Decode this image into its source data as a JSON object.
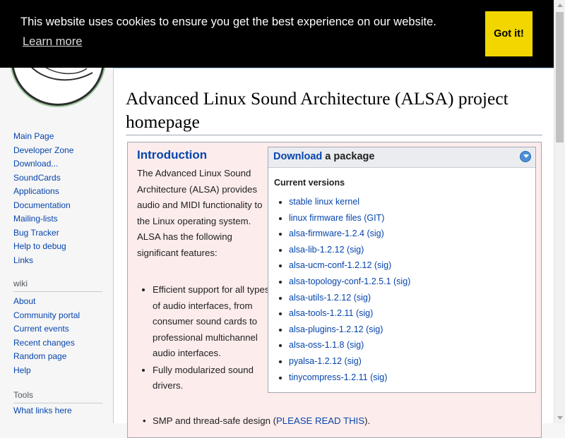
{
  "cookie": {
    "message": "This website uses cookies to ensure you get the best experience on our website.",
    "learn_more": "Learn more",
    "button": "Got it!"
  },
  "sidebar": {
    "navigation": [
      "Main Page",
      "Developer Zone",
      "Download...",
      "SoundCards",
      "Applications",
      "Documentation",
      "Mailing-lists",
      "Bug Tracker",
      "Help to debug",
      "Links"
    ],
    "wiki_heading": "wiki",
    "wiki": [
      "About",
      "Community portal",
      "Current events",
      "Recent changes",
      "Random page",
      "Help"
    ],
    "tools_heading": "Tools",
    "tools": [
      "What links here"
    ]
  },
  "page": {
    "title": "Advanced Linux Sound Architecture (ALSA) project homepage",
    "intro_heading": "Introduction",
    "intro_text": "The Advanced Linux Sound Architecture (ALSA) provides audio and MIDI functionality to the Linux operating system. ALSA has the following significant features:",
    "features": [
      "Efficient support for all types of audio interfaces, from consumer sound cards to professional multichannel audio interfaces.",
      "Fully modularized sound drivers."
    ],
    "feature_smp_prefix": "SMP and thread-safe design (",
    "feature_smp_link": "PLEASE READ THIS",
    "feature_smp_suffix": ")."
  },
  "download": {
    "header_link": "Download",
    "header_rest": " a package",
    "current_versions": "Current versions",
    "versions": [
      "stable linux kernel",
      "linux firmware files (GIT)",
      "alsa-firmware-1.2.4 (sig)",
      "alsa-lib-1.2.12 (sig)",
      "alsa-ucm-conf-1.2.12 (sig)",
      "alsa-topology-conf-1.2.5.1 (sig)",
      "alsa-utils-1.2.12 (sig)",
      "alsa-tools-1.2.11 (sig)",
      "alsa-plugins-1.2.12 (sig)",
      "alsa-oss-1.1.8 (sig)",
      "pyalsa-1.2.12 (sig)",
      "tinycompress-1.2.11 (sig)"
    ]
  }
}
